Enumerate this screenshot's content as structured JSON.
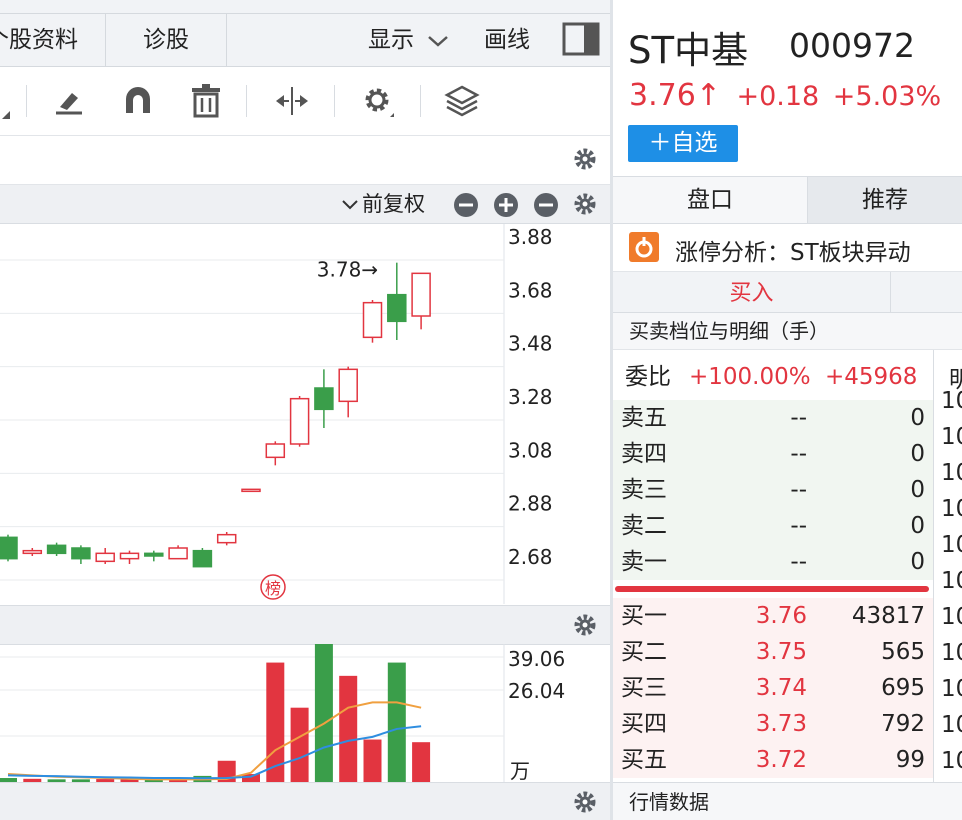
{
  "tabs": {
    "profile": "个股资料",
    "diagnose": "诊股",
    "display": "显示",
    "draw": "画线"
  },
  "chart_header": {
    "adjust": "前复权"
  },
  "chart_data": {
    "type": "candlestick",
    "y_ticks": [
      "3.88",
      "3.68",
      "3.48",
      "3.28",
      "3.08",
      "2.88",
      "2.68"
    ],
    "high_label": "3.78→",
    "badge": "榜",
    "candles": [
      {
        "o": 2.75,
        "c": 2.67,
        "h": 2.76,
        "l": 2.66
      },
      {
        "o": 2.69,
        "c": 2.7,
        "h": 2.71,
        "l": 2.68
      },
      {
        "o": 2.72,
        "c": 2.69,
        "h": 2.73,
        "l": 2.68
      },
      {
        "o": 2.71,
        "c": 2.67,
        "h": 2.72,
        "l": 2.65
      },
      {
        "o": 2.66,
        "c": 2.69,
        "h": 2.71,
        "l": 2.65
      },
      {
        "o": 2.67,
        "c": 2.69,
        "h": 2.7,
        "l": 2.65
      },
      {
        "o": 2.69,
        "c": 2.68,
        "h": 2.7,
        "l": 2.66
      },
      {
        "o": 2.67,
        "c": 2.71,
        "h": 2.72,
        "l": 2.67
      },
      {
        "o": 2.7,
        "c": 2.64,
        "h": 2.71,
        "l": 2.64
      },
      {
        "o": 2.73,
        "c": 2.76,
        "h": 2.77,
        "l": 2.72
      },
      {
        "o": 2.93,
        "c": 2.93,
        "h": 2.93,
        "l": 2.93
      },
      {
        "o": 3.05,
        "c": 3.1,
        "h": 3.11,
        "l": 3.02
      },
      {
        "o": 3.1,
        "c": 3.27,
        "h": 3.28,
        "l": 3.09
      },
      {
        "o": 3.31,
        "c": 3.23,
        "h": 3.38,
        "l": 3.16
      },
      {
        "o": 3.26,
        "c": 3.38,
        "h": 3.39,
        "l": 3.2
      },
      {
        "o": 3.5,
        "c": 3.63,
        "h": 3.64,
        "l": 3.48
      },
      {
        "o": 3.66,
        "c": 3.56,
        "h": 3.78,
        "l": 3.49
      },
      {
        "o": 3.58,
        "c": 3.74,
        "h": 3.74,
        "l": 3.53
      }
    ],
    "volume": {
      "y_ticks": [
        "39.06",
        "26.04"
      ],
      "unit": "万",
      "bars": [
        1.5,
        1.2,
        1.0,
        1.0,
        1.1,
        1.1,
        1.1,
        1.0,
        2.3,
        8.0,
        3.0,
        45.0,
        28.0,
        52.0,
        40.0,
        16.0,
        45.0,
        15.0
      ],
      "ma5": [
        3.0,
        2.5,
        2.0,
        1.8,
        1.5,
        1.2,
        1.0,
        1.0,
        1.0,
        1.2,
        3.5,
        12.0,
        17.0,
        22.0,
        28.0,
        30.0,
        30.0,
        28.0
      ],
      "ma10": [
        2.5,
        2.3,
        2.2,
        2.0,
        1.8,
        1.7,
        1.5,
        1.5,
        1.4,
        1.5,
        2.0,
        6.0,
        9.0,
        13.0,
        15.5,
        17.0,
        20.0,
        21.0
      ]
    }
  },
  "stock": {
    "name": "ST中基",
    "code": "000972",
    "price": "3.76↑",
    "change": "+0.18",
    "pct": "+5.03%",
    "add": "＋自选"
  },
  "right_tabs": {
    "quote": "盘口",
    "recommend": "推荐"
  },
  "alert": {
    "text": "涨停分析：ST板块异动"
  },
  "buy_tab": "买入",
  "orderbook": {
    "title": "买卖档位与明细（手）",
    "ratio_label": "委比",
    "ratio_pct": "+100.00%",
    "ratio_diff": "+45968",
    "cutoff": "明",
    "sells": [
      {
        "label": "卖五",
        "price": "--",
        "vol": "0"
      },
      {
        "label": "卖四",
        "price": "--",
        "vol": "0"
      },
      {
        "label": "卖三",
        "price": "--",
        "vol": "0"
      },
      {
        "label": "卖二",
        "price": "--",
        "vol": "0"
      },
      {
        "label": "卖一",
        "price": "--",
        "vol": "0"
      }
    ],
    "buys": [
      {
        "label": "买一",
        "price": "3.76",
        "vol": "43817"
      },
      {
        "label": "买二",
        "price": "3.75",
        "vol": "565"
      },
      {
        "label": "买三",
        "price": "3.74",
        "vol": "695"
      },
      {
        "label": "买四",
        "price": "3.73",
        "vol": "792"
      },
      {
        "label": "买五",
        "price": "3.72",
        "vol": "99"
      }
    ],
    "tick_prefix": [
      "10",
      "10",
      "10",
      "10",
      "10",
      "10",
      "10",
      "10",
      "10",
      "10",
      "10"
    ]
  },
  "footer": {
    "market_data": "行情数据"
  },
  "colors": {
    "up": "#e23540",
    "down": "#3a9e4a",
    "ma5": "#f0a040",
    "ma10": "#2f8ee0"
  }
}
